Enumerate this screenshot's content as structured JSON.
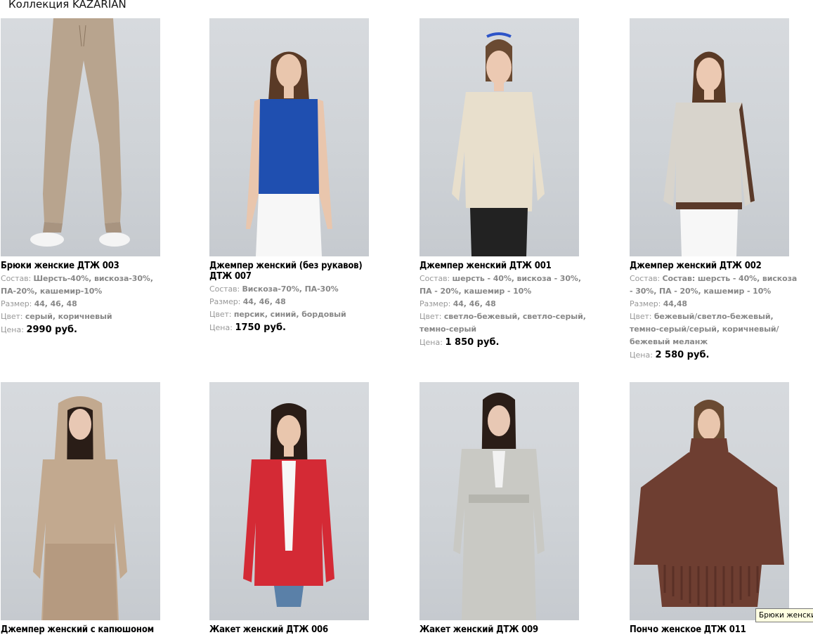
{
  "page": {
    "title": "Коллекция KAZARIAN"
  },
  "labels": {
    "composition": "Состав:",
    "size": "Размер:",
    "color": "Цвет:",
    "price": "Цена:"
  },
  "tooltip": {
    "text": "Брюки женски"
  },
  "products": [
    {
      "name": "Брюки женские ДТЖ 003",
      "composition": "Шерсть-40%, вискоза-30%, ПА-20%, кашемир-10%",
      "sizes": "44, 46, 48",
      "colors": "серый, коричневый",
      "price": "2990 руб.",
      "garment_color": "#b8a48e",
      "garment": "pants"
    },
    {
      "name": "Джемпер женский (без рукавов) ДТЖ 007",
      "composition": "Вискоза-70%, ПА-30%",
      "sizes": "44, 46, 48",
      "colors": "персик, синий, бордовый",
      "price": "1750 руб.",
      "garment_color": "#1f4fb0",
      "garment": "vest"
    },
    {
      "name": "Джемпер женский ДТЖ 001",
      "composition": "шерсть - 40%, вискоза - 30%, ПА - 20%, кашемир - 10%",
      "sizes": "44, 46, 48",
      "colors": "светло-бежевый, светло-серый, темно-серый",
      "price": "1 850 руб.",
      "garment_color": "#e8dfcc",
      "garment": "sweater"
    },
    {
      "name": "Джемпер женский ДТЖ 002",
      "composition": "Состав: шерсть - 40%, вискоза - 30%, ПА - 20%, кашемир - 10%",
      "sizes": "44,48",
      "colors": "бежевый/светло-бежевый, темно-серый/серый, коричневый/ бежевый меланж",
      "price": "2 580 руб.",
      "garment_color": "#d8d4cc",
      "garment": "sweater"
    },
    {
      "name": "Джемпер женский с капюшоном",
      "garment_color": "#c2a98f",
      "garment": "dress"
    },
    {
      "name": "Жакет женский ДТЖ 006",
      "garment_color": "#d42a35",
      "garment": "cardigan"
    },
    {
      "name": "Жакет женский ДТЖ 009",
      "garment_color": "#c9c9c4",
      "garment": "coat"
    },
    {
      "name": "Пончо женское ДТЖ 011",
      "garment_color": "#6e3e31",
      "garment": "poncho"
    }
  ]
}
